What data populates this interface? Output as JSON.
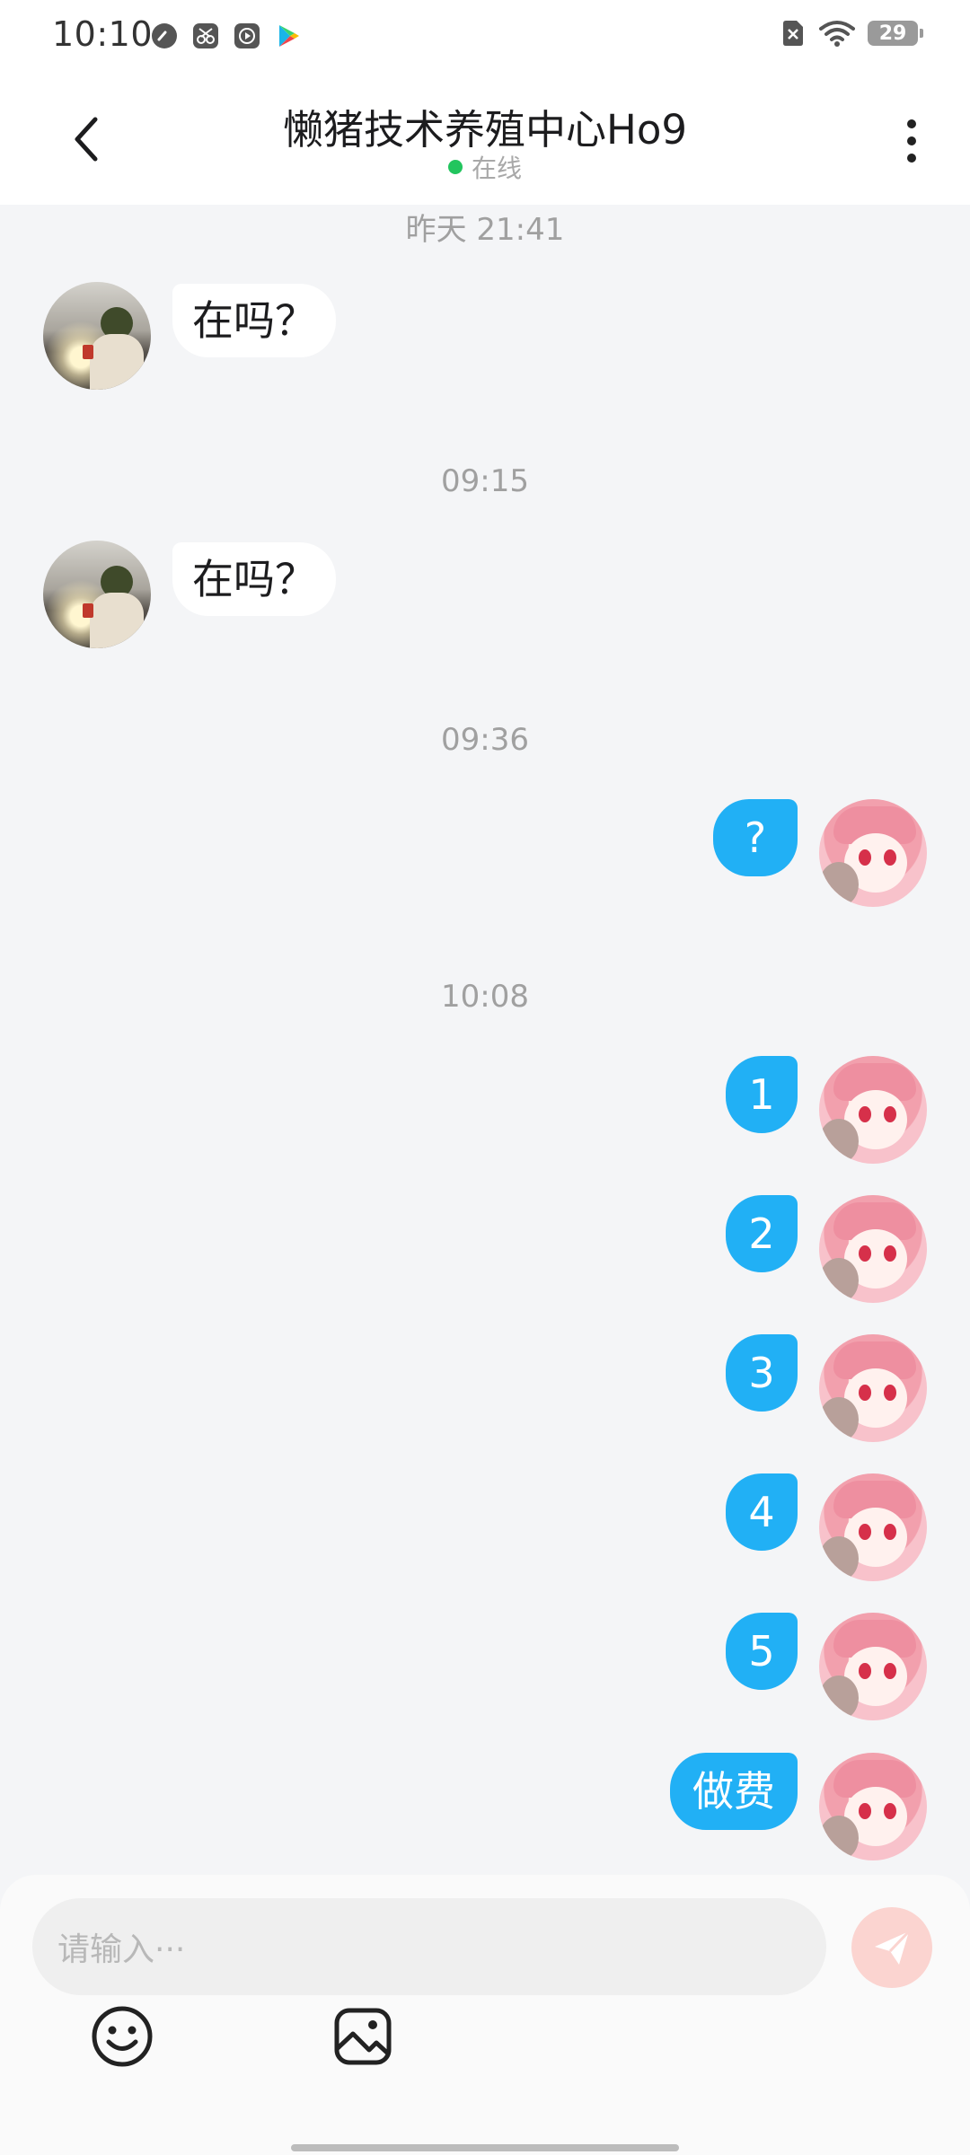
{
  "status_bar": {
    "time": "10:10",
    "battery": "29",
    "left_icons": [
      "speedometer-icon",
      "scissors-app-icon",
      "play-box-icon",
      "play-store-icon"
    ],
    "right_icons": [
      "sim-off-icon",
      "wifi-icon",
      "battery-icon"
    ]
  },
  "header": {
    "title": "懒猪技术养殖中心Ho9",
    "status": "在线",
    "status_color": "#22c55e",
    "back_icon": "chevron-left-icon",
    "more_icon": "more-vertical-icon"
  },
  "chat": {
    "timestamps": [
      "昨天 21:41",
      "09:15",
      "09:36",
      "10:08"
    ],
    "messages": [
      {
        "side": "incoming",
        "text": "在吗？"
      },
      {
        "side": "incoming",
        "text": "在吗？"
      },
      {
        "side": "outgoing",
        "text": "?"
      },
      {
        "side": "outgoing",
        "text": "1"
      },
      {
        "side": "outgoing",
        "text": "2"
      },
      {
        "side": "outgoing",
        "text": "3"
      },
      {
        "side": "outgoing",
        "text": "4"
      },
      {
        "side": "outgoing",
        "text": "5"
      },
      {
        "side": "outgoing",
        "text": "做费"
      }
    ],
    "outgoing_bubble_color": "#21b0f5",
    "incoming_bubble_color": "#ffffff"
  },
  "composer": {
    "placeholder": "请输入···",
    "send_icon": "send-plane-icon",
    "send_color": "#fbd4d0",
    "tools": [
      "emoji-icon",
      "image-icon"
    ]
  }
}
